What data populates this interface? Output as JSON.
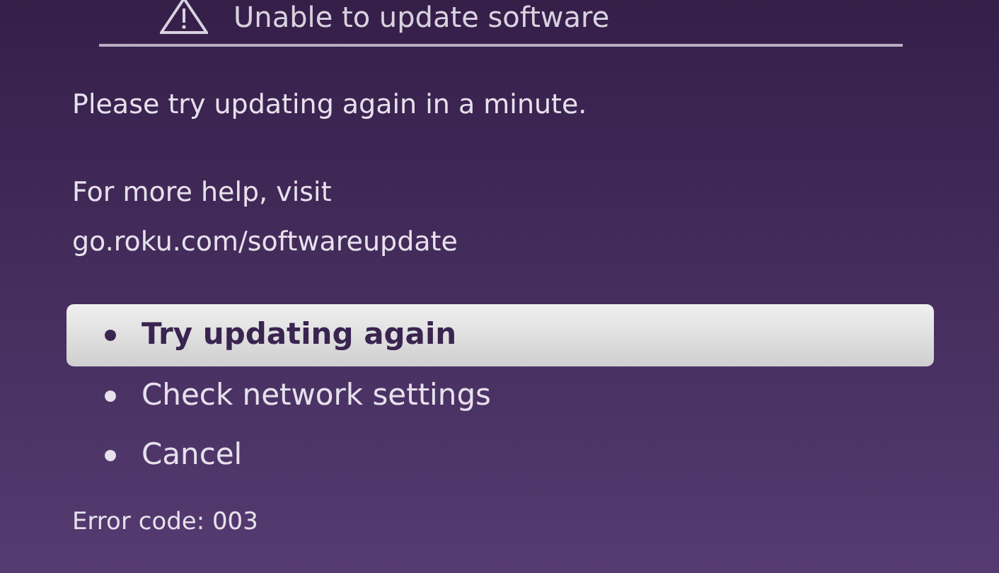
{
  "dialog": {
    "title": "Unable to update software",
    "message": "Please try updating again in a minute.",
    "help_text": "For more help, visit",
    "help_link": "go.roku.com/softwareupdate",
    "options": [
      {
        "label": "Try updating again",
        "selected": true
      },
      {
        "label": "Check network settings",
        "selected": false
      },
      {
        "label": "Cancel",
        "selected": false
      }
    ],
    "error_code": "Error code: 003"
  }
}
